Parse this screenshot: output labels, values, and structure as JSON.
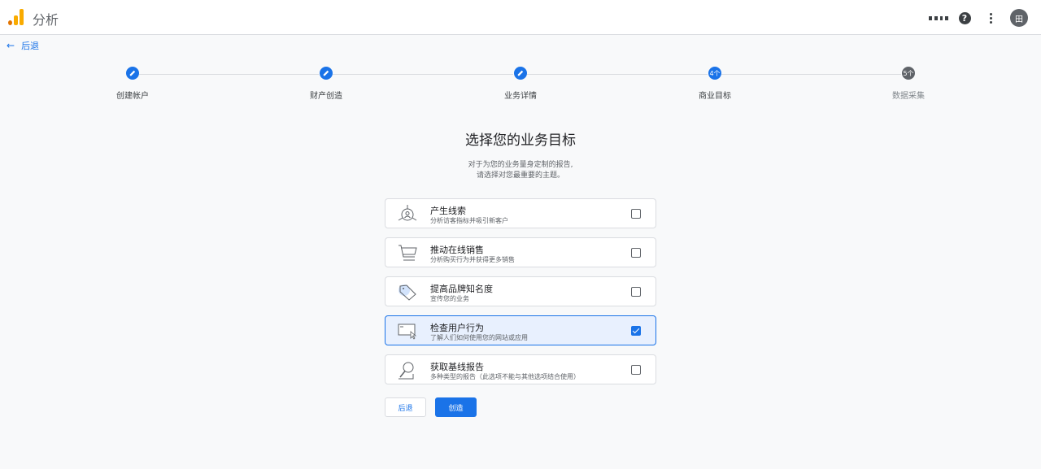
{
  "app": {
    "title": "分析"
  },
  "header": {
    "apps_icon": "apps-grid-icon",
    "help_icon": "help-icon",
    "more_icon": "more-vert-icon",
    "avatar_text": "田"
  },
  "nav": {
    "back_label": "后退"
  },
  "stepper": {
    "steps": [
      {
        "label": "创建帐户",
        "state": "done",
        "marker": ""
      },
      {
        "label": "财产创造",
        "state": "done",
        "marker": ""
      },
      {
        "label": "业务详情",
        "state": "done",
        "marker": ""
      },
      {
        "label": "商业目标",
        "state": "current",
        "marker": "4个"
      },
      {
        "label": "数据采集",
        "state": "future",
        "marker": "5个"
      }
    ]
  },
  "page": {
    "title": "选择您的业务目标",
    "subtitle_line1": "对于为您的业务量身定制的报告,",
    "subtitle_line2": "请选择对您最重要的主题。"
  },
  "options": [
    {
      "title": "产生线索",
      "description": "分析访客指标并吸引新客户",
      "checked": false,
      "icon": "leads-icon"
    },
    {
      "title": "推动在线销售",
      "description": "分析购买行为并获得更多销售",
      "checked": false,
      "icon": "cart-icon"
    },
    {
      "title": "提高品牌知名度",
      "description": "宣传您的业务",
      "checked": false,
      "icon": "tag-icon"
    },
    {
      "title": "检查用户行为",
      "description": "了解人们如何使用您的网站或应用",
      "checked": true,
      "icon": "screen-cursor-icon"
    },
    {
      "title": "获取基线报告",
      "description": "多种类型的报告（此选项不能与其他选项结合使用）",
      "checked": false,
      "icon": "magnifier-icon"
    }
  ],
  "actions": {
    "back_label": "后退",
    "create_label": "创造"
  },
  "colors": {
    "accent": "#1a73e8",
    "selected_bg": "#e8f0fe"
  }
}
